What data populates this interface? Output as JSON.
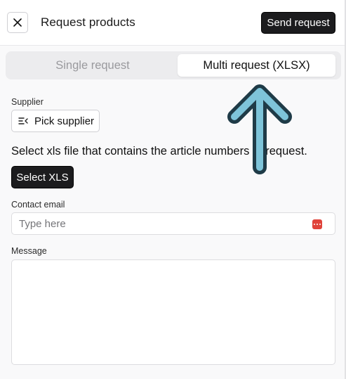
{
  "header": {
    "title": "Request products",
    "send_label": "Send request",
    "close_icon": "close-icon"
  },
  "tabs": [
    {
      "label": "Single request",
      "active": false
    },
    {
      "label": "Multi request (XLSX)",
      "active": true
    }
  ],
  "supplier": {
    "label": "Supplier",
    "button_label": "Pick supplier",
    "icon": "list-pick-icon"
  },
  "xls": {
    "hint": "Select xls file that contains the article numbers to request.",
    "button_label": "Select XLS"
  },
  "contact": {
    "label": "Contact email",
    "value": "",
    "placeholder": "Type here",
    "icon": "password-manager-icon"
  },
  "message": {
    "label": "Message",
    "value": ""
  },
  "annotation": {
    "arrow_icon": "up-arrow-annotation-icon",
    "arrow_color": "#7ec4d9",
    "outline_color": "#1f3b47"
  },
  "colors": {
    "primary_button": "#1c1c1e",
    "badge_red": "#e0433a"
  }
}
